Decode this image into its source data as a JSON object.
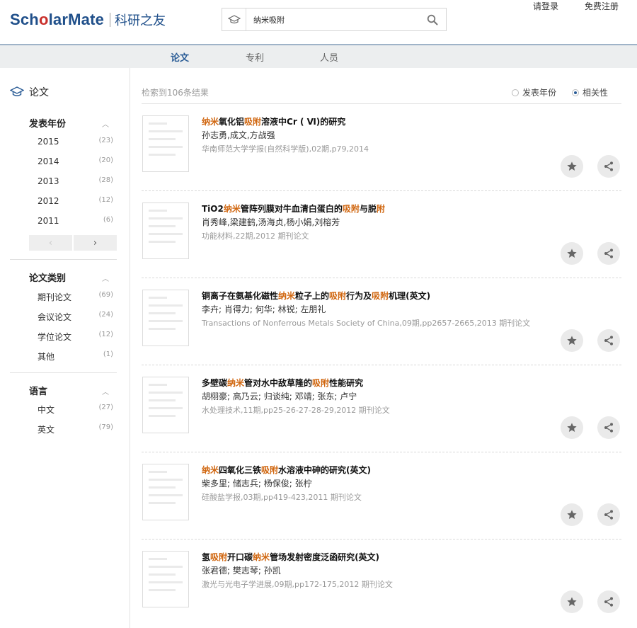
{
  "header": {
    "logo_pre": "Sch",
    "logo_o": "o",
    "logo_post": "larMate",
    "logo_cn": "科研之友",
    "search_value": "纳米吸附",
    "login": "请登录",
    "register": "免费注册"
  },
  "nav": {
    "tabs": [
      {
        "label": "论文"
      },
      {
        "label": "专利"
      },
      {
        "label": "人员"
      }
    ]
  },
  "sidebar": {
    "title": "论文",
    "sections": [
      {
        "title": "发表年份",
        "items": [
          {
            "label": "2015",
            "count": "(23)"
          },
          {
            "label": "2014",
            "count": "(20)"
          },
          {
            "label": "2013",
            "count": "(28)"
          },
          {
            "label": "2012",
            "count": "(12)"
          },
          {
            "label": "2011",
            "count": "(6)"
          }
        ]
      },
      {
        "title": "论文类别",
        "items": [
          {
            "label": "期刊论文",
            "count": "(69)"
          },
          {
            "label": "会议论文",
            "count": "(24)"
          },
          {
            "label": "学位论文",
            "count": "(12)"
          },
          {
            "label": "其他",
            "count": "(1)"
          }
        ]
      },
      {
        "title": "语言",
        "items": [
          {
            "label": "中文",
            "count": "(27)"
          },
          {
            "label": "英文",
            "count": "(79)"
          }
        ]
      }
    ]
  },
  "results": {
    "count_text": "检索到106条结果",
    "sort_year": "发表年份",
    "sort_relevance": "相关性",
    "selected_sort": "相关性",
    "papers": [
      {
        "title_segments": [
          {
            "t": "纳米",
            "hl": true
          },
          {
            "t": "氧化铝"
          },
          {
            "t": "吸附",
            "hl": true
          },
          {
            "t": "溶液中Cr ( Ⅵ)的研究"
          }
        ],
        "authors": "孙志勇,成文,方战强",
        "source": "华南师范大学学报(自然科学版),02期,p79,2014"
      },
      {
        "title_segments": [
          {
            "t": "TiO2"
          },
          {
            "t": "纳米",
            "hl": true
          },
          {
            "t": "管阵列膜对牛血清白蛋白的"
          },
          {
            "t": "吸附",
            "hl": true
          },
          {
            "t": "与脱"
          },
          {
            "t": "附",
            "hl": true
          }
        ],
        "authors": "肖秀峰,梁建鹤,汤海贞,杨小娟,刘榕芳",
        "source": "功能材料,22期,2012 期刊论文"
      },
      {
        "title_segments": [
          {
            "t": "铜离子在氨基化磁性"
          },
          {
            "t": "纳米",
            "hl": true
          },
          {
            "t": "粒子上的"
          },
          {
            "t": "吸附",
            "hl": true
          },
          {
            "t": "行为及"
          },
          {
            "t": "吸附",
            "hl": true
          },
          {
            "t": "机理(英文)"
          }
        ],
        "authors": "李卉; 肖得力; 何华; 林锐; 左朋礼",
        "source": "Transactions of Nonferrous Metals Society of China,09期,pp2657-2665,2013 期刊论文"
      },
      {
        "title_segments": [
          {
            "t": "多壁碳"
          },
          {
            "t": "纳米",
            "hl": true
          },
          {
            "t": "管对水中敌草隆的"
          },
          {
            "t": "吸附",
            "hl": true
          },
          {
            "t": "性能研究"
          }
        ],
        "authors": "胡栩豪; 高乃云; 归谈纯; 邓靖; 张东; 卢宁",
        "source": "水处理技术,11期,pp25-26-27-28-29,2012 期刊论文"
      },
      {
        "title_segments": [
          {
            "t": "纳米",
            "hl": true
          },
          {
            "t": "四氧化三铁"
          },
          {
            "t": "吸附",
            "hl": true
          },
          {
            "t": "水溶液中砷的研究(英文)"
          }
        ],
        "authors": "柴多里; 储志兵; 杨保俊; 张柠",
        "source": "硅酸盐学报,03期,pp419-423,2011 期刊论文"
      },
      {
        "title_segments": [
          {
            "t": "氢"
          },
          {
            "t": "吸附",
            "hl": true
          },
          {
            "t": "开口碳"
          },
          {
            "t": "纳米",
            "hl": true
          },
          {
            "t": "管场发射密度泛函研究(英文)"
          }
        ],
        "authors": "张君德; 樊志琴; 孙凯",
        "source": "激光与光电子学进展,09期,pp172-175,2012 期刊论文"
      }
    ]
  },
  "colors": {
    "accent": "#2a5c96",
    "highlight": "#d0660f",
    "logo_red": "#c9302c"
  },
  "icons": {
    "search": "search-icon",
    "cap": "graduation-cap-icon",
    "star": "star-icon",
    "share": "share-icon"
  }
}
